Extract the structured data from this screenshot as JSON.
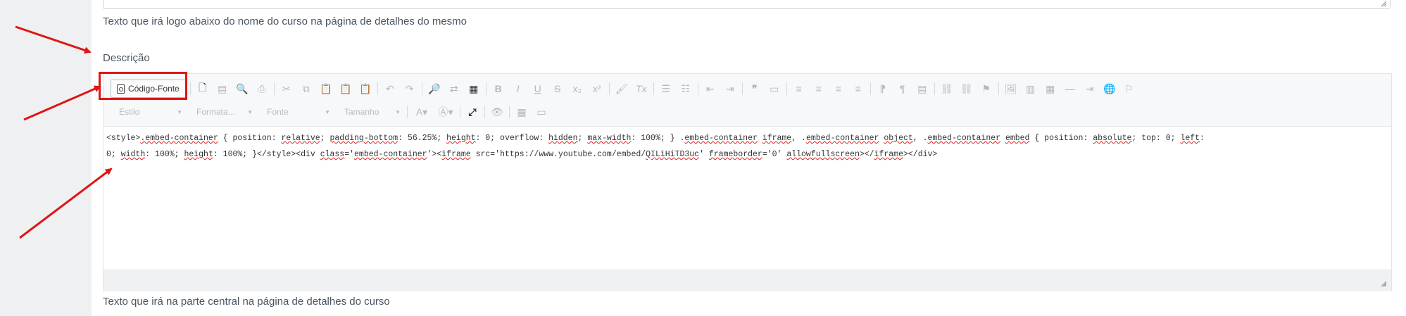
{
  "help_top": "Texto que irá logo abaixo do nome do curso na página de detalhes do mesmo",
  "description_label": "Descrição",
  "toolbar": {
    "source_button": "Código-Fonte",
    "row1_icons": [
      "new-page",
      "templates",
      "preview",
      "print",
      "cut",
      "copy",
      "paste",
      "paste-text",
      "paste-word",
      "undo",
      "redo",
      "find",
      "replace",
      "select-all",
      "bold",
      "italic",
      "underline",
      "strike",
      "subscript",
      "superscript",
      "copy-format",
      "remove-format",
      "numbered-list",
      "bulleted-list",
      "outdent",
      "indent",
      "blockquote",
      "create-div",
      "align-left",
      "align-center",
      "align-right",
      "justify",
      "ltr",
      "rtl",
      "language",
      "link",
      "unlink",
      "anchor",
      "image",
      "chart",
      "table",
      "horizontal-rule",
      "indent-increase",
      "iframe",
      "flag"
    ],
    "combos": [
      "Estilo",
      "Formata...",
      "Fonte",
      "Tamanho"
    ],
    "row2_icons": [
      "text-color",
      "background-color",
      "maximize",
      "show-blocks",
      "table-grid",
      "insert-field"
    ]
  },
  "source_code": {
    "line1_parts": [
      "<style>",
      ".embed-container",
      " { position: ",
      "relative",
      "; ",
      "padding-bottom",
      ": 56.25%; ",
      "height",
      ": 0; overflow: ",
      "hidden",
      "; ",
      "max-width",
      ": 100%; } .",
      "embed-container",
      " ",
      "iframe",
      ", .",
      "embed-container",
      " ",
      "object",
      ", .",
      "embed-container",
      " ",
      "embed",
      " { position: ",
      "absolute",
      "; top: 0; ",
      "left",
      ":"
    ],
    "line2_parts": [
      "0; ",
      "width",
      ": 100%; ",
      "height",
      ": 100%; }</style><div ",
      "class",
      "='",
      "embed-container",
      "'><",
      "iframe",
      " src='https://www.youtube.com/embed/",
      "QILiHiTD3uc",
      "' ",
      "frameborder",
      "='0' ",
      "allowfullscreen",
      "></",
      "iframe",
      "></div>"
    ]
  },
  "help_bottom": "Texto que irá na parte central na página de detalhes do curso",
  "colors": {
    "annotation": "#e01515",
    "text": "#4a5562"
  }
}
